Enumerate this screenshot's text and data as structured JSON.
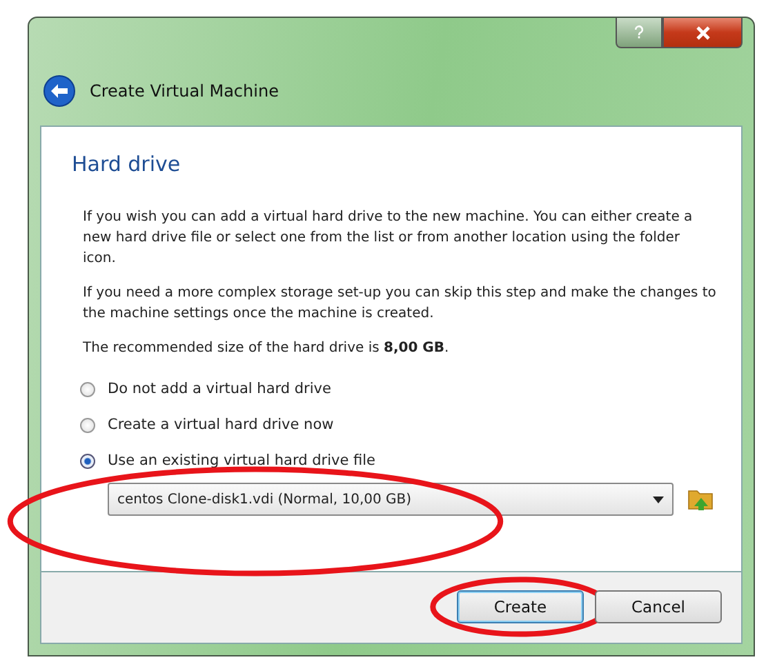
{
  "window": {
    "title": "Create Virtual Machine"
  },
  "page": {
    "heading": "Hard drive",
    "paragraphs": [
      "If you wish you can add a virtual hard drive to the new machine. You can either create a new hard drive file or select one from the list or from another location using the folder icon.",
      "If you need a more complex storage set-up you can skip this step and make the changes to the machine settings once the machine is created.",
      "The recommended size of the hard drive is **8,00 GB**."
    ]
  },
  "options": [
    {
      "label": "Do not add a virtual hard drive",
      "selected": false
    },
    {
      "label": "Create a virtual hard drive now",
      "selected": false
    },
    {
      "label": "Use an existing virtual hard drive file",
      "selected": true
    }
  ],
  "file_select": {
    "value": "centos Clone-disk1.vdi (Normal, 10,00 GB)",
    "circled": true
  },
  "buttons": [
    {
      "label": "Create",
      "default": true,
      "circled": true
    },
    {
      "label": "Cancel",
      "default": false,
      "circled": false
    }
  ]
}
